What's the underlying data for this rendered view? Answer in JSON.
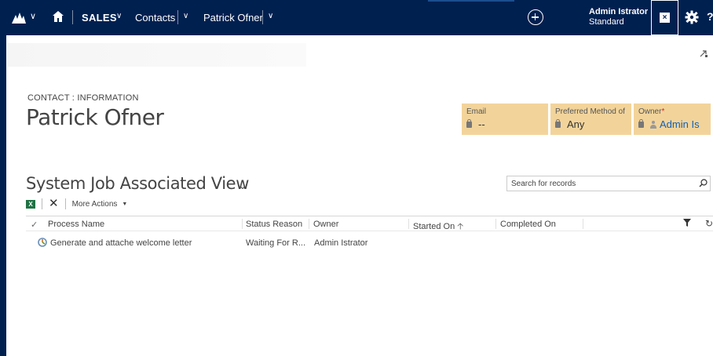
{
  "nav": {
    "sales": "SALES",
    "contacts": "Contacts",
    "record": "Patrick Ofner",
    "user_name": "Admin Istrator",
    "user_role": "Standard",
    "help": "?"
  },
  "header": {
    "entity_label": "CONTACT : INFORMATION",
    "title": "Patrick Ofner",
    "fields": [
      {
        "label": "Email",
        "value": "--"
      },
      {
        "label": "Preferred Method of",
        "value": "Any"
      },
      {
        "label": "Owner",
        "value": "Admin Is",
        "required_mark": "*"
      }
    ]
  },
  "view": {
    "title": "System Job Associated View",
    "search_placeholder": "Search for records",
    "more_actions": "More Actions",
    "columns": [
      "Process Name",
      "Status Reason",
      "Owner",
      "Started On",
      "Completed On"
    ],
    "rows": [
      {
        "process_name": "Generate and attache welcome letter",
        "status_reason": "Waiting For R...",
        "owner": "Admin Istrator",
        "started_on": "",
        "completed_on": ""
      }
    ]
  },
  "colors": {
    "nav_bg": "#002050",
    "header_field_bg": "#f2d49b",
    "link": "#1160b7",
    "required": "#e02020",
    "excel": "#1f7244"
  },
  "icons": [
    "app-logo-icon",
    "home-icon",
    "plus-circle-icon",
    "excel-icon",
    "gear-icon",
    "popout-icon",
    "lock-icon",
    "person-icon",
    "search-icon",
    "delete-icon",
    "filter-icon",
    "refresh-icon",
    "process-icon",
    "sort-up-icon"
  ]
}
